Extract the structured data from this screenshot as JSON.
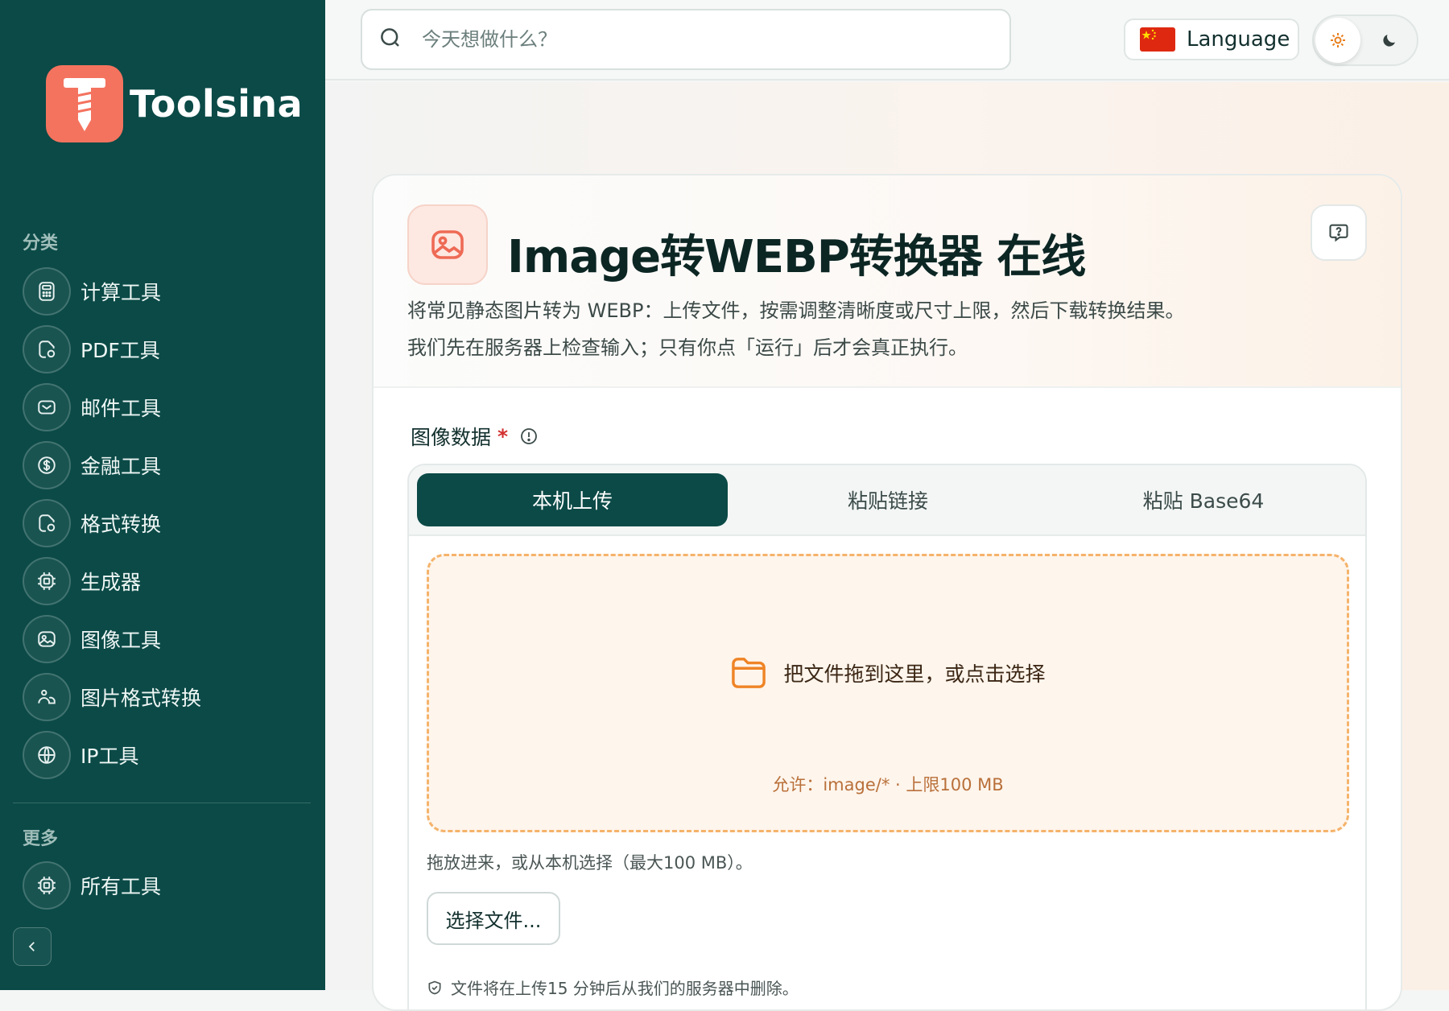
{
  "sidebar": {
    "brand": "Toolsina",
    "section_title": "分类",
    "items": [
      {
        "label": "计算工具",
        "icon": "calculator-icon"
      },
      {
        "label": "PDF工具",
        "icon": "file-icon"
      },
      {
        "label": "邮件工具",
        "icon": "mail-icon"
      },
      {
        "label": "金融工具",
        "icon": "dollar-icon"
      },
      {
        "label": "格式转换",
        "icon": "file-convert-icon"
      },
      {
        "label": "生成器",
        "icon": "cpu-icon"
      },
      {
        "label": "图像工具",
        "icon": "image-icon"
      },
      {
        "label": "图片格式转换",
        "icon": "image-person-icon"
      },
      {
        "label": "IP工具",
        "icon": "globe-icon"
      }
    ],
    "more_title": "更多",
    "more_items": [
      {
        "label": "所有工具",
        "icon": "cpu-icon"
      }
    ]
  },
  "topbar": {
    "search_placeholder": "今天想做什么？",
    "language_label": "Language"
  },
  "tool": {
    "title": "Image转WEBP转换器 在线",
    "desc_line1": "将常见静态图片转为 WEBP：上传文件，按需调整清晰度或尺寸上限，然后下载转换结果。",
    "desc_line2": "我们先在服务器上检查输入；只有你点「运行」后才会真正执行。",
    "field_label": "图像数据",
    "required_mark": "*",
    "tabs": [
      "本机上传",
      "粘贴链接",
      "粘贴 Base64"
    ],
    "active_tab": 0,
    "dropzone_text": "把文件拖到这里，或点击选择",
    "dropzone_allow": "允许：image/* · 上限100 MB",
    "hint": "拖放进来，或从本机选择（最大100 MB）。",
    "choose_button": "选择文件...",
    "note": "文件将在上传15 分钟后从我们的服务器中删除。"
  },
  "colors": {
    "sidebar_bg": "#0b4a47",
    "brand_accent": "#f4735f",
    "dropzone_border": "#f5b36b",
    "active_tab_bg": "#0b4a47"
  }
}
